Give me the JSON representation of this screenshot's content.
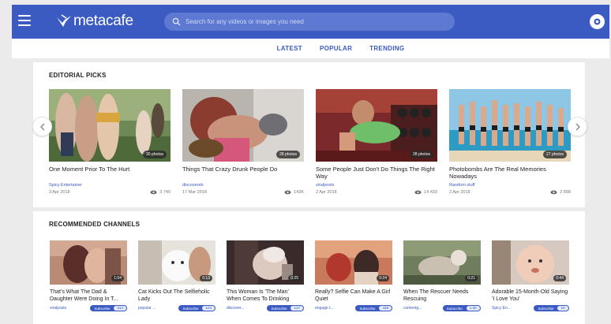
{
  "header": {
    "logo_text": "metacafe",
    "search_placeholder": "Search for any videos or images you need",
    "brand_color": "#3b5bc3"
  },
  "subnav": [
    "LATEST",
    "POPULAR",
    "TRENDING"
  ],
  "editorial": {
    "title": "EDITORIAL PICKS",
    "items": [
      {
        "badge": "30 photos",
        "title": "One Moment Prior To The Hurt",
        "source": "Spicy Entertainer",
        "date": "3 Apr 2018",
        "views": "3 740"
      },
      {
        "badge": "28 photos",
        "title": "Things That Crazy Drunk People Do",
        "source": "discovereb",
        "date": "17 Mar 2018",
        "views": "143K"
      },
      {
        "badge": "28 photos",
        "title": "Some People Just Don't Do Things The Right Way",
        "source": "viralposts",
        "date": "2 Apr 2018",
        "views": "14 433"
      },
      {
        "badge": "27 photos",
        "title": "Photobombs Are The Real Memories Nowadays",
        "source": "Random stuff",
        "date": "2 Apr 2018",
        "views": "2 898"
      }
    ]
  },
  "channels": {
    "title": "RECOMMENDED CHANNELS",
    "subscribe_label": "Subscribe",
    "items": [
      {
        "duration": "1:04",
        "title": "That's What The Dad & Daughter Were Doing In T...",
        "source": "viralposts",
        "count": "314"
      },
      {
        "duration": "0:13",
        "title": "Cat Kicks Out The Selfieholic Lady",
        "source": "popular ...",
        "count": "104"
      },
      {
        "duration": "0:25",
        "title": "This Woman Is 'The Man' When Comes To Drinking",
        "source": "discover...",
        "count": "127"
      },
      {
        "duration": "0:24",
        "title": "Really? Selfie Can Make A Girl Quiet",
        "source": "engage t...",
        "count": "438"
      },
      {
        "duration": "0:21",
        "title": "When The Rescuer Needs Rescuing",
        "source": "contentg...",
        "count": "1.3K"
      },
      {
        "duration": "0:44",
        "title": "Adorable 15-Month-Old Saying 'I Love You'",
        "source": "Spicy En...",
        "count": "1K"
      }
    ]
  }
}
